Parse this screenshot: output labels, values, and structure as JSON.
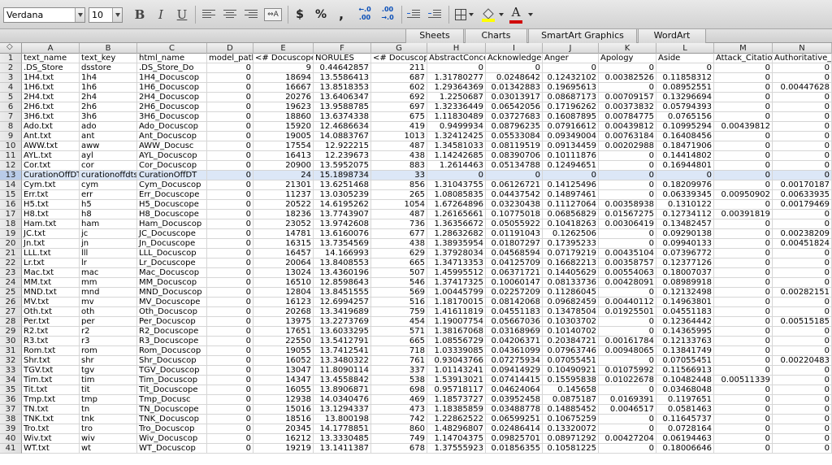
{
  "toolbar": {
    "font_name": "Verdana",
    "font_size": "10",
    "bold": "B",
    "italic": "I",
    "underline": "U",
    "currency": "$",
    "percent": "%",
    "comma": ",",
    "inc_decimal": "←.0\n.00",
    "dec_decimal": ".00\n→.0",
    "font_color_letter": "A",
    "font_color": "#d00000",
    "highlight_color": "#ffff00"
  },
  "ribbon": {
    "tabs": [
      "Sheets",
      "Charts",
      "SmartArt Graphics",
      "WordArt"
    ]
  },
  "columns": [
    "A",
    "B",
    "C",
    "D",
    "E",
    "F",
    "G",
    "H",
    "I",
    "J",
    "K",
    "L",
    "M",
    "N"
  ],
  "selected_row": 13,
  "rows": [
    [
      "1",
      "text_name",
      "text_key",
      "html_name",
      "model_path",
      "<# Docuscope",
      "NORULES",
      "<# Docuscope",
      "AbstractConce",
      "Acknowledge",
      "Anger",
      "Apology",
      "Aside",
      "Attack_Citatio",
      "Authoritative_"
    ],
    [
      "2",
      ".DS_Store",
      "dsstore",
      ".DS_Store_Do",
      "0",
      "9",
      "0.44642857",
      "211",
      "0",
      "0",
      "0",
      "0",
      "0",
      "0",
      "0"
    ],
    [
      "3",
      "1H4.txt",
      "1h4",
      "1H4_Docuscop",
      "0",
      "18694",
      "13.5586413",
      "687",
      "1.31780277",
      "0.0248642",
      "0.12432102",
      "0.00382526",
      "0.11858312",
      "0",
      "0"
    ],
    [
      "4",
      "1H6.txt",
      "1h6",
      "1H6_Docuscop",
      "0",
      "16667",
      "13.8518353",
      "602",
      "1.29364369",
      "0.01342883",
      "0.19695613",
      "0",
      "0.08952551",
      "0",
      "0.00447628"
    ],
    [
      "5",
      "2H4.txt",
      "2h4",
      "2H4_Docuscop",
      "0",
      "20276",
      "13.6406347",
      "692",
      "1.2250687",
      "0.03013917",
      "0.08687173",
      "0.00709157",
      "0.13296694",
      "0",
      "0"
    ],
    [
      "6",
      "2H6.txt",
      "2h6",
      "2H6_Docuscop",
      "0",
      "19623",
      "13.9588785",
      "697",
      "1.32336449",
      "0.06542056",
      "0.17196262",
      "0.00373832",
      "0.05794393",
      "0",
      "0"
    ],
    [
      "7",
      "3H6.txt",
      "3h6",
      "3H6_Docuscop",
      "0",
      "18860",
      "13.6374338",
      "675",
      "1.11830489",
      "0.03727683",
      "0.16087895",
      "0.00784775",
      "0.0765156",
      "0",
      "0"
    ],
    [
      "8",
      "Ado.txt",
      "ado",
      "Ado_Docuscop",
      "0",
      "15920",
      "12.4686634",
      "419",
      "0.9499934",
      "0.08796235",
      "0.07916612",
      "0.00439812",
      "0.10995294",
      "0.00439812",
      "0"
    ],
    [
      "9",
      "Ant.txt",
      "ant",
      "Ant_Docuscop",
      "0",
      "19005",
      "14.0883767",
      "1013",
      "1.32412425",
      "0.05533084",
      "0.09349004",
      "0.00763184",
      "0.16408456",
      "0",
      "0"
    ],
    [
      "10",
      "AWW.txt",
      "aww",
      "AWW_Docusc",
      "0",
      "17554",
      "12.922215",
      "487",
      "1.34581033",
      "0.08119519",
      "0.09134459",
      "0.00202988",
      "0.18471906",
      "0",
      "0"
    ],
    [
      "11",
      "AYL.txt",
      "ayl",
      "AYL_Docuscop",
      "0",
      "16413",
      "12.239673",
      "438",
      "1.14242685",
      "0.08390706",
      "0.10111876",
      "0",
      "0.14414802",
      "0",
      "0"
    ],
    [
      "12",
      "Cor.txt",
      "cor",
      "Cor_Docuscop",
      "0",
      "20900",
      "13.5952075",
      "883",
      "1.2614463",
      "0.05134788",
      "0.12494651",
      "0",
      "0.16944801",
      "0",
      "0"
    ],
    [
      "13",
      "CurationOffDT",
      "curationoffdtst",
      "CurationOffDT",
      "0",
      "24",
      "15.1898734",
      "33",
      "0",
      "0",
      "0",
      "0",
      "0",
      "0",
      "0"
    ],
    [
      "14",
      "Cym.txt",
      "cym",
      "Cym_Docuscop",
      "0",
      "21301",
      "13.6251468",
      "856",
      "1.31043755",
      "0.06126721",
      "0.14125496",
      "0",
      "0.18209976",
      "0",
      "0.00170187"
    ],
    [
      "15",
      "Err.txt",
      "err",
      "Err_Docuscope",
      "0",
      "11237",
      "13.0305239",
      "265",
      "1.08085835",
      "0.04437542",
      "0.14897461",
      "0",
      "0.06339345",
      "0.00950902",
      "0.00633935"
    ],
    [
      "16",
      "H5.txt",
      "h5",
      "H5_Docuscope",
      "0",
      "20522",
      "14.6195262",
      "1054",
      "1.67264896",
      "0.03230438",
      "0.11127064",
      "0.00358938",
      "0.1310122",
      "0",
      "0.00179469"
    ],
    [
      "17",
      "H8.txt",
      "h8",
      "H8_Docuscope",
      "0",
      "18236",
      "13.7743907",
      "487",
      "1.26165661",
      "0.10775018",
      "0.06856829",
      "0.01567275",
      "0.12734112",
      "0.00391819",
      "0"
    ],
    [
      "18",
      "Ham.txt",
      "ham",
      "Ham_Docuscop",
      "0",
      "23052",
      "13.9742608",
      "736",
      "1.36356672",
      "0.05055922",
      "0.10418263",
      "0.00306419",
      "0.13482457",
      "0",
      "0"
    ],
    [
      "19",
      "JC.txt",
      "jc",
      "JC_Docuscope",
      "0",
      "14781",
      "13.6160076",
      "677",
      "1.28632682",
      "0.01191043",
      "0.1262506",
      "0",
      "0.09290138",
      "0",
      "0.00238209"
    ],
    [
      "20",
      "Jn.txt",
      "jn",
      "Jn_Docuscope",
      "0",
      "16315",
      "13.7354569",
      "438",
      "1.38935954",
      "0.01807297",
      "0.17395233",
      "0",
      "0.09940133",
      "0",
      "0.00451824"
    ],
    [
      "21",
      "LLL.txt",
      "lll",
      "LLL_Docuscop",
      "0",
      "16457",
      "14.166993",
      "629",
      "1.37928034",
      "0.04568594",
      "0.07179219",
      "0.00435104",
      "0.07396772",
      "0",
      "0"
    ],
    [
      "22",
      "Lr.txt",
      "lr",
      "Lr_Docuscope",
      "0",
      "20064",
      "13.8408553",
      "665",
      "1.34713353",
      "0.04125709",
      "0.16682213",
      "0.00358757",
      "0.12377126",
      "0",
      "0"
    ],
    [
      "23",
      "Mac.txt",
      "mac",
      "Mac_Docuscop",
      "0",
      "13024",
      "13.4360196",
      "507",
      "1.45995512",
      "0.06371721",
      "0.14405629",
      "0.00554063",
      "0.18007037",
      "0",
      "0"
    ],
    [
      "24",
      "MM.txt",
      "mm",
      "MM_Docuscop",
      "0",
      "16510",
      "12.8598643",
      "546",
      "1.37417325",
      "0.10060147",
      "0.08133736",
      "0.00428091",
      "0.08989918",
      "0",
      "0"
    ],
    [
      "25",
      "MND.txt",
      "mnd",
      "MND_Docuscop",
      "0",
      "12804",
      "13.8451555",
      "569",
      "1.00445799",
      "0.02257209",
      "0.11286045",
      "0",
      "0.12132498",
      "0",
      "0.00282151"
    ],
    [
      "26",
      "MV.txt",
      "mv",
      "MV_Docuscope",
      "0",
      "16123",
      "12.6994257",
      "516",
      "1.18170015",
      "0.08142068",
      "0.09682459",
      "0.00440112",
      "0.14963801",
      "0",
      "0"
    ],
    [
      "27",
      "Oth.txt",
      "oth",
      "Oth_Docuscop",
      "0",
      "20268",
      "13.3419689",
      "759",
      "1.41611819",
      "0.04551183",
      "0.13478504",
      "0.01925501",
      "0.04551183",
      "0",
      "0"
    ],
    [
      "28",
      "Per.txt",
      "per",
      "Per_Docuscop",
      "0",
      "13975",
      "13.2273769",
      "454",
      "1.19007754",
      "0.05667036",
      "0.10303702",
      "0",
      "0.12364442",
      "0",
      "0.00515185"
    ],
    [
      "29",
      "R2.txt",
      "r2",
      "R2_Docuscope",
      "0",
      "17651",
      "13.6033295",
      "571",
      "1.38167068",
      "0.03168969",
      "0.10140702",
      "0",
      "0.14365995",
      "0",
      "0"
    ],
    [
      "30",
      "R3.txt",
      "r3",
      "R3_Docuscope",
      "0",
      "22550",
      "13.5412791",
      "665",
      "1.08556729",
      "0.04206371",
      "0.20384721",
      "0.00161784",
      "0.12133763",
      "0",
      "0"
    ],
    [
      "31",
      "Rom.txt",
      "rom",
      "Rom_Docuscop",
      "0",
      "19055",
      "13.7412541",
      "718",
      "1.03339085",
      "0.04361099",
      "0.07963746",
      "0.00948065",
      "0.13841749",
      "0",
      "0"
    ],
    [
      "32",
      "Shr.txt",
      "shr",
      "Shr_Docuscop",
      "0",
      "16052",
      "13.3480322",
      "761",
      "0.93043766",
      "0.07275934",
      "0.07055451",
      "0",
      "0.07055451",
      "0",
      "0.00220483"
    ],
    [
      "33",
      "TGV.txt",
      "tgv",
      "TGV_Docuscop",
      "0",
      "13047",
      "11.8090114",
      "337",
      "1.01143241",
      "0.09414929",
      "0.10490921",
      "0.01075992",
      "0.11566913",
      "0",
      "0"
    ],
    [
      "34",
      "Tim.txt",
      "tim",
      "Tim_Docuscop",
      "0",
      "14347",
      "13.4558842",
      "538",
      "1.53913021",
      "0.07414415",
      "0.15595838",
      "0.01022678",
      "0.10482448",
      "0.00511339",
      "0"
    ],
    [
      "35",
      "Tit.txt",
      "tit",
      "Tit_Docuscope",
      "0",
      "16055",
      "13.8906871",
      "698",
      "0.95718117",
      "0.04624064",
      "0.145658",
      "0",
      "0.03468048",
      "0",
      "0"
    ],
    [
      "36",
      "Tmp.txt",
      "tmp",
      "Tmp_Docusc",
      "0",
      "12938",
      "14.0340476",
      "469",
      "1.18573727",
      "0.03952458",
      "0.0875187",
      "0.0169391",
      "0.1197651",
      "0",
      "0"
    ],
    [
      "37",
      "TN.txt",
      "tn",
      "TN_Docuscope",
      "0",
      "15016",
      "13.1294337",
      "473",
      "1.18385859",
      "0.03488778",
      "0.14885452",
      "0.0046517",
      "0.0581463",
      "0",
      "0"
    ],
    [
      "38",
      "TNK.txt",
      "tnk",
      "TNK_Docuscop",
      "0",
      "18516",
      "13.800198",
      "742",
      "1.22862522",
      "0.06599251",
      "0.10675259",
      "0",
      "0.11645737",
      "0",
      "0"
    ],
    [
      "39",
      "Tro.txt",
      "tro",
      "Tro_Docuscop",
      "0",
      "20345",
      "14.1778851",
      "860",
      "1.48296807",
      "0.02486414",
      "0.13320072",
      "0",
      "0.0728164",
      "0",
      "0"
    ],
    [
      "40",
      "Wiv.txt",
      "wiv",
      "Wiv_Docuscop",
      "0",
      "16212",
      "13.3330485",
      "749",
      "1.14704375",
      "0.09825701",
      "0.08971292",
      "0.00427204",
      "0.06194463",
      "0",
      "0"
    ],
    [
      "41",
      "WT.txt",
      "wt",
      "WT_Docuscop",
      "0",
      "19219",
      "13.1411387",
      "678",
      "1.37555923",
      "0.01856355",
      "0.10581225",
      "0",
      "0.18006646",
      "0",
      "0"
    ]
  ]
}
